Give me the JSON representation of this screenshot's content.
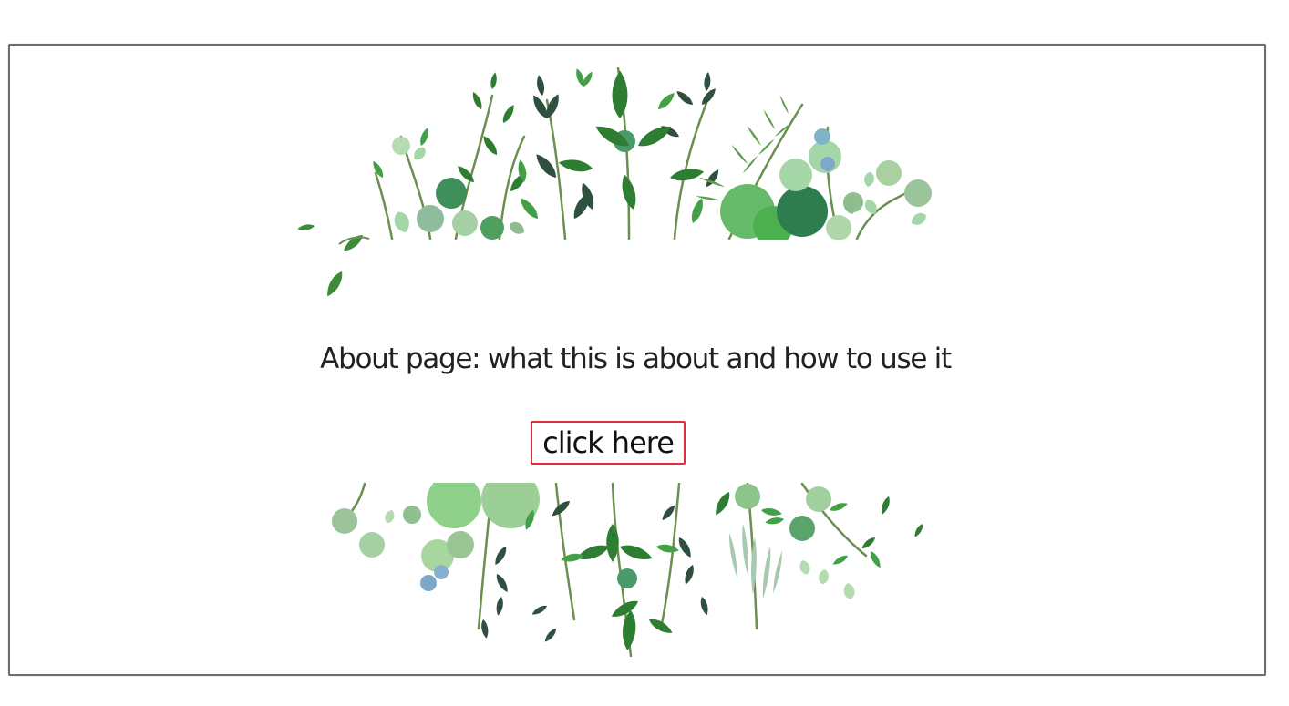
{
  "about": {
    "text": "About page: what this is about and how to use it"
  },
  "button": {
    "label": "click here",
    "border_color": "#e0303e"
  },
  "decor": {
    "top_icon": "leaf-garland-icon",
    "bottom_icon": "leaf-garland-icon",
    "leaf_colors": [
      "#2e7d32",
      "#43a047",
      "#66bb6a",
      "#1b5e20",
      "#2f4f3f",
      "#8fbc8f",
      "#a5d6a7",
      "#7fb3a8"
    ]
  }
}
